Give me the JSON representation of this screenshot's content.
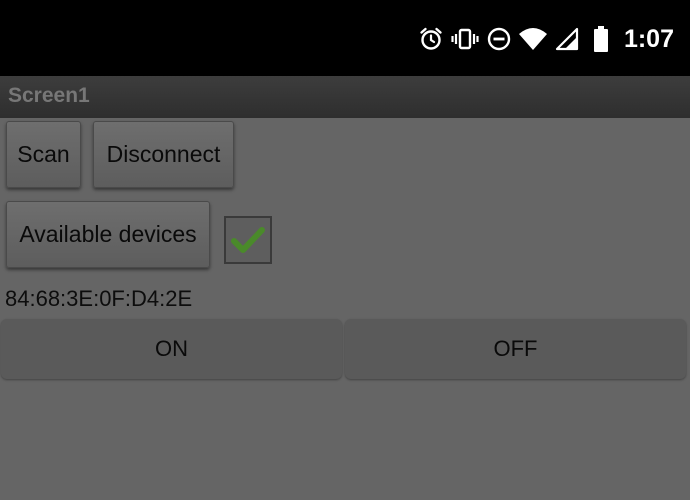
{
  "status_bar": {
    "time": "1:07",
    "icons": [
      "alarm-icon",
      "vibrate-icon",
      "do-not-disturb-icon",
      "wifi-icon",
      "cell-signal-icon",
      "battery-icon"
    ]
  },
  "title_bar": {
    "title": "Screen1"
  },
  "buttons": {
    "scan": "Scan",
    "disconnect": "Disconnect",
    "available_devices": "Available devices",
    "on": "ON",
    "off": "OFF"
  },
  "checkbox": {
    "checked": true,
    "check_color": "#4a8a2a"
  },
  "device": {
    "address": "84:68:3E:0F:D4:2E"
  }
}
